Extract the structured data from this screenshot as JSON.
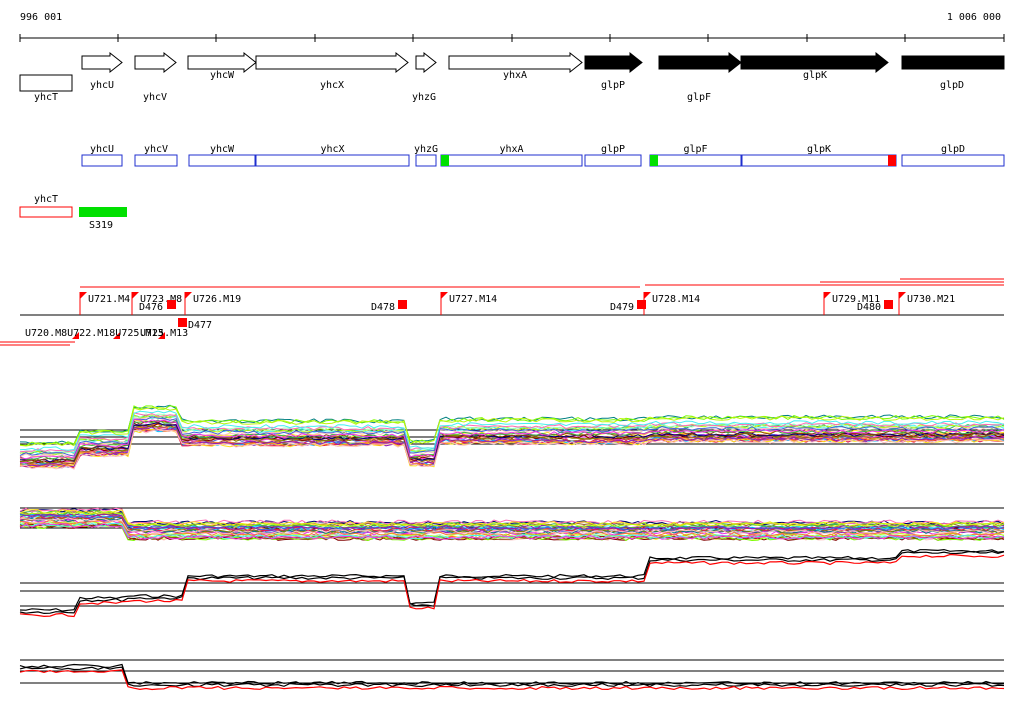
{
  "axis": {
    "start_label": "996 001",
    "end_label": "1 006 000"
  },
  "genes": [
    {
      "name": "yhcT",
      "strand": "none",
      "fill": "white"
    },
    {
      "name": "yhcU",
      "strand": "+",
      "fill": "white"
    },
    {
      "name": "yhcV",
      "strand": "+",
      "fill": "white"
    },
    {
      "name": "yhcW",
      "strand": "+",
      "fill": "white"
    },
    {
      "name": "yhcX",
      "strand": "+",
      "fill": "white"
    },
    {
      "name": "yhzG",
      "strand": "+",
      "fill": "white"
    },
    {
      "name": "yhxA",
      "strand": "+",
      "fill": "white"
    },
    {
      "name": "glpP",
      "strand": "+",
      "fill": "black"
    },
    {
      "name": "glpF",
      "strand": "+",
      "fill": "black"
    },
    {
      "name": "glpK",
      "strand": "+",
      "fill": "black"
    },
    {
      "name": "glpD",
      "strand": "+",
      "fill": "black"
    }
  ],
  "feature_boxes": [
    {
      "name": "yhcU"
    },
    {
      "name": "yhcV"
    },
    {
      "name": "yhcW"
    },
    {
      "name": "yhcX"
    },
    {
      "name": "yhzG"
    },
    {
      "name": "yhxA"
    },
    {
      "name": "glpP"
    },
    {
      "name": "glpF"
    },
    {
      "name": "glpK"
    },
    {
      "name": "glpD"
    }
  ],
  "lower_features": [
    {
      "name": "yhcT",
      "style": "red-outline"
    },
    {
      "name": "S319",
      "style": "green-filled"
    }
  ],
  "upshifts": [
    "U721.M4",
    "U723.M8",
    "U726.M19",
    "U727.M14",
    "U728.M14",
    "U729.M11",
    "U730.M21",
    "U720.M8",
    "U722.M18",
    "U725.M13"
  ],
  "upshift_overlap_label": "U720.M8U722.M18U725.M13",
  "downshifts": [
    "D476",
    "D477",
    "D478",
    "D479",
    "D480"
  ],
  "colors": {
    "gene_black": "#000000",
    "box_blue": "#1f2fcf",
    "marker_red": "#ff0000",
    "marker_green": "#00e000",
    "condition_palette": [
      "#e6194b",
      "#3cb44b",
      "#ffe119",
      "#4363d8",
      "#f58231",
      "#911eb4",
      "#46f0f0",
      "#f032e6",
      "#bcf60c",
      "#fabebe",
      "#008080",
      "#9a6324",
      "#800000",
      "#aaffc3",
      "#808000",
      "#000075",
      "#ff69b4",
      "#00bfff",
      "#7cfc00",
      "#8b4513"
    ]
  },
  "icons": {
    "gene_arrow": "right-arrow-shape"
  },
  "tracks": [
    {
      "id": "expression-upper",
      "style": "multi-condition"
    },
    {
      "id": "expression-lower",
      "style": "multi-condition"
    },
    {
      "id": "strand-plus",
      "style": "black-red-pair"
    },
    {
      "id": "strand-minus",
      "style": "black-red-pair"
    }
  ]
}
